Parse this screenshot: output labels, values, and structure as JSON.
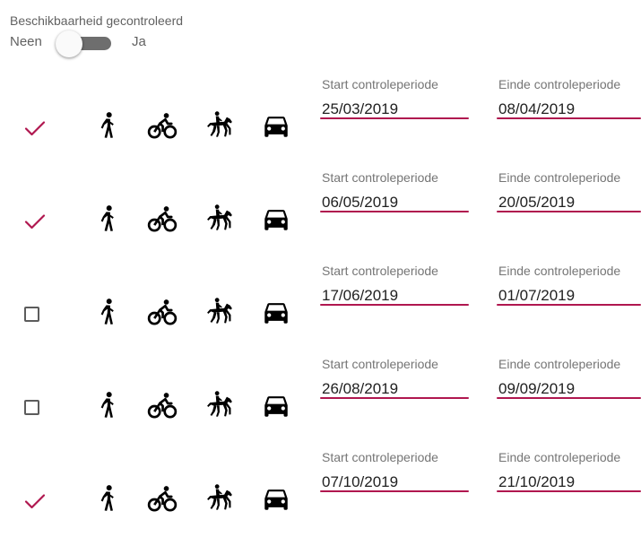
{
  "availability": {
    "title": "Beschikbaarheid gecontroleerd",
    "no_label": "Neen",
    "yes_label": "Ja",
    "checked": false
  },
  "field_labels": {
    "start": "Start controleperiode",
    "end": "Einde controleperiode"
  },
  "icons": [
    "pedestrian-icon",
    "bicycle-icon",
    "horse-rider-icon",
    "car-icon"
  ],
  "colors": {
    "accent": "#b0174f",
    "icon": "#000000",
    "muted": "#757575"
  },
  "periods": [
    {
      "checked": true,
      "start": "25/03/2019",
      "end": "08/04/2019"
    },
    {
      "checked": true,
      "start": "06/05/2019",
      "end": "20/05/2019"
    },
    {
      "checked": false,
      "start": "17/06/2019",
      "end": "01/07/2019"
    },
    {
      "checked": false,
      "start": "26/08/2019",
      "end": "09/09/2019"
    },
    {
      "checked": true,
      "start": "07/10/2019",
      "end": "21/10/2019"
    }
  ]
}
